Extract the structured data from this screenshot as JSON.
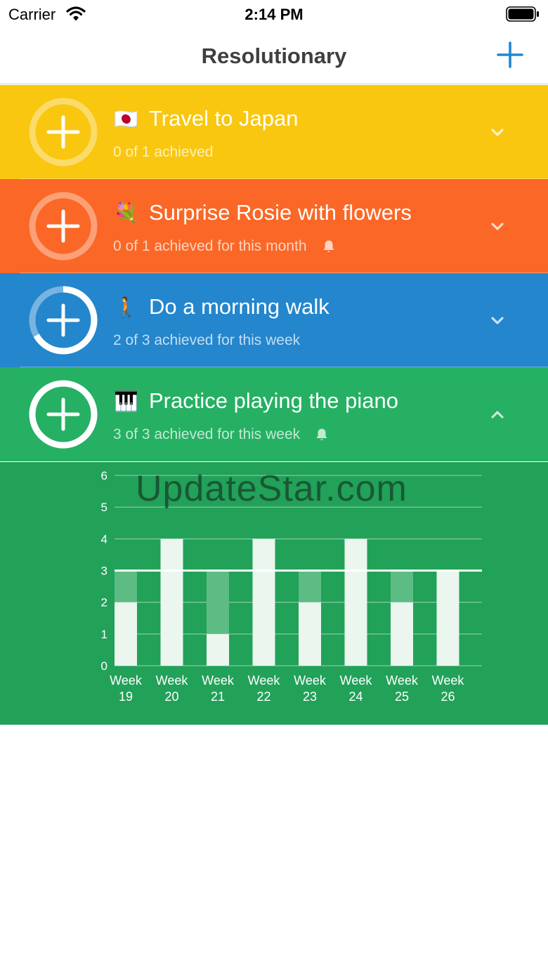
{
  "status_bar": {
    "carrier": "Carrier",
    "time": "2:14 PM"
  },
  "nav": {
    "title": "Resolutionary",
    "add_icon": "plus-icon"
  },
  "goals": [
    {
      "emoji": "🇯🇵",
      "title": "Travel to Japan",
      "subtitle": "0 of 1 achieved",
      "color": "#f9c710",
      "progress": 0,
      "has_reminder": false,
      "expanded": false
    },
    {
      "emoji": "💐",
      "title": "Surprise Rosie with flowers",
      "subtitle": "0 of 1 achieved for this month",
      "color": "#fb6726",
      "progress": 0,
      "has_reminder": true,
      "expanded": false
    },
    {
      "emoji": "🚶",
      "title": "Do a morning walk",
      "subtitle": "2 of 3 achieved for this week",
      "color": "#2486cd",
      "progress": 0.667,
      "has_reminder": false,
      "expanded": false
    },
    {
      "emoji": "🎹",
      "title": "Practice playing the piano",
      "subtitle": "3 of 3 achieved for this week",
      "color": "#25b063",
      "progress": 1,
      "has_reminder": true,
      "expanded": true
    }
  ],
  "chart_data": {
    "type": "bar",
    "categories": [
      "Week 19",
      "Week 20",
      "Week 21",
      "Week 22",
      "Week 23",
      "Week 24",
      "Week 25",
      "Week 26"
    ],
    "category_lines": [
      [
        "Week",
        "19"
      ],
      [
        "Week",
        "20"
      ],
      [
        "Week",
        "21"
      ],
      [
        "Week",
        "22"
      ],
      [
        "Week",
        "23"
      ],
      [
        "Week",
        "24"
      ],
      [
        "Week",
        "25"
      ],
      [
        "Week",
        "26"
      ]
    ],
    "series": [
      {
        "values": [
          2,
          4,
          1,
          4,
          2,
          4,
          2,
          3
        ]
      }
    ],
    "target": 3,
    "ylim": [
      0,
      6
    ],
    "yticks": [
      "0",
      "1",
      "2",
      "3",
      "4",
      "5",
      "6"
    ],
    "grid": true,
    "colors": {
      "background": "#22a159",
      "bar": "#eaf6ee",
      "shortfall": "#5cbc84",
      "grid": "#ffffff"
    }
  },
  "watermark": "UpdateStar.com"
}
